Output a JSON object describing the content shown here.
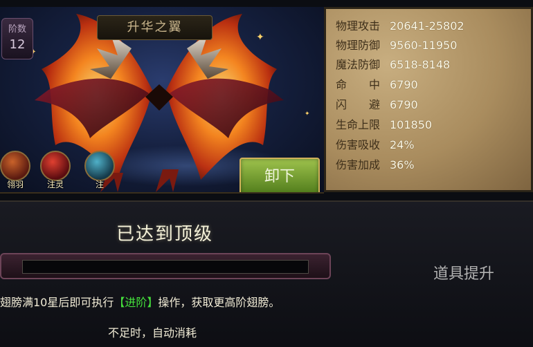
{
  "scene": {
    "title": "升华之翼",
    "tier_label": "阶数",
    "tier_value": "12",
    "unload_button": "卸下",
    "func_buttons": [
      {
        "label": "翎羽",
        "icon": "feather-icon"
      },
      {
        "label": "注灵",
        "icon": "soul-icon"
      },
      {
        "label": "注",
        "icon": "infuse-icon"
      }
    ]
  },
  "stats": [
    {
      "key": "物理攻击",
      "value": "20641-25802"
    },
    {
      "key": "物理防御",
      "value": "9560-11950"
    },
    {
      "key": "魔法防御",
      "value": "6518-8148"
    },
    {
      "key": "命　　中",
      "value": "6790"
    },
    {
      "key": "闪　　避",
      "value": "6790"
    },
    {
      "key": "生命上限",
      "value": "101850"
    },
    {
      "key": "伤害吸收",
      "value": "24%"
    },
    {
      "key": "伤害加成",
      "value": "36%"
    }
  ],
  "lower": {
    "max_text": "已达到顶级",
    "desc_before": "翅膀满10星后即可执行",
    "desc_highlight": "【进阶】",
    "desc_after": "操作，获取更高阶翅膀。",
    "auto_text": "不足时，自动消耗",
    "upgrade_button": "道具提升",
    "progress": 0
  },
  "colors": {
    "highlight": "#45e23c",
    "stat_value": "#fffbe8",
    "stat_key": "#3e2f1a"
  }
}
